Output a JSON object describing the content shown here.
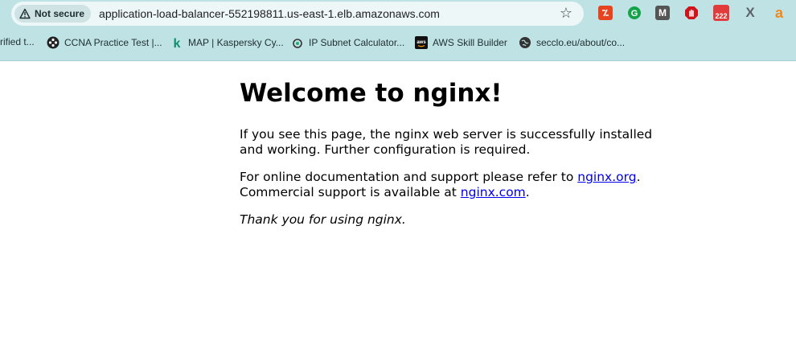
{
  "browser": {
    "security_label": "Not secure",
    "url": "application-load-balancer-552198811.us-east-1.elb.amazonaws.com",
    "extensions": [
      {
        "name": "extension-red-icon",
        "glyph": "⅟",
        "color": "#e8431f"
      },
      {
        "name": "grammarly-icon",
        "glyph": "G",
        "color": "#15a34a"
      },
      {
        "name": "m-extension-icon",
        "glyph": "M",
        "color": "#555555"
      },
      {
        "name": "adblock-icon",
        "glyph": "✋",
        "color": "#d0141b"
      },
      {
        "name": "calendar-badge-icon",
        "glyph": "222",
        "color": "#e23b3b"
      },
      {
        "name": "x-icon",
        "glyph": "X",
        "color": "#5f6368"
      },
      {
        "name": "amazon-assistant-icon",
        "glyph": "a",
        "color": "#f0891b"
      }
    ]
  },
  "bookmarks": [
    {
      "label": "rified t...",
      "icon": "none"
    },
    {
      "label": "CCNA Practice Test |...",
      "icon": "ccna-icon"
    },
    {
      "label": "MAP | Kaspersky Cy...",
      "icon": "kaspersky-icon"
    },
    {
      "label": "IP Subnet Calculator...",
      "icon": "subnet-calculator-icon"
    },
    {
      "label": "AWS Skill Builder",
      "icon": "aws-icon"
    },
    {
      "label": "secclo.eu/about/co...",
      "icon": "globe-icon"
    }
  ],
  "page": {
    "heading": "Welcome to nginx!",
    "para1": "If you see this page, the nginx web server is successfully installed and working. Further configuration is required.",
    "para2_prefix": "For online documentation and support please refer to ",
    "link1": "nginx.org",
    "para2_mid": ".",
    "para2_line2_prefix": "Commercial support is available at ",
    "link2": "nginx.com",
    "para2_suffix": ".",
    "para3": "Thank you for using nginx."
  },
  "colors": {
    "toolbar_bg": "#bfe3e5",
    "link": "#0000ee"
  }
}
